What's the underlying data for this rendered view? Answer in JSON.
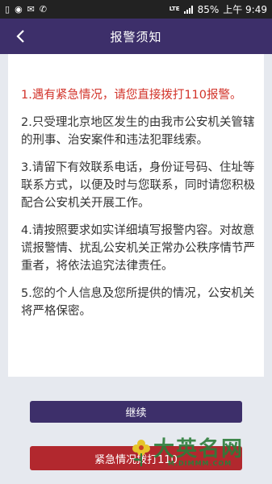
{
  "status_bar": {
    "network": "LTE",
    "battery": "85%",
    "time": "上午 9:49"
  },
  "header": {
    "title": "报警须知"
  },
  "notices": [
    "1.遇有紧急情况，请您直接拨打110报警。",
    "2.只受理北京地区发生的由我市公安机关管辖的刑事、治安案件和违法犯罪线索。",
    "3.请留下有效联系电话，身份证号码、住址等联系方式，以便及时与您联系，同时请您积极配合公安机关开展工作。",
    "4.请按照要求如实详细填写报警内容。对故意谎报警情、扰乱公安机关正常办公秩序情节严重者，将依法追究法律责任。",
    "5.您的个人信息及您所提供的情况，公安机关将严格保密。"
  ],
  "buttons": {
    "continue": "继续",
    "emergency": "紧急情况拨打110"
  },
  "watermark": {
    "text": "大英名网",
    "url": "M.DIMMM.COM"
  },
  "colors": {
    "nav": "#3d2f6a",
    "warning_text": "#d2332a",
    "emergency": "#b2282e"
  }
}
